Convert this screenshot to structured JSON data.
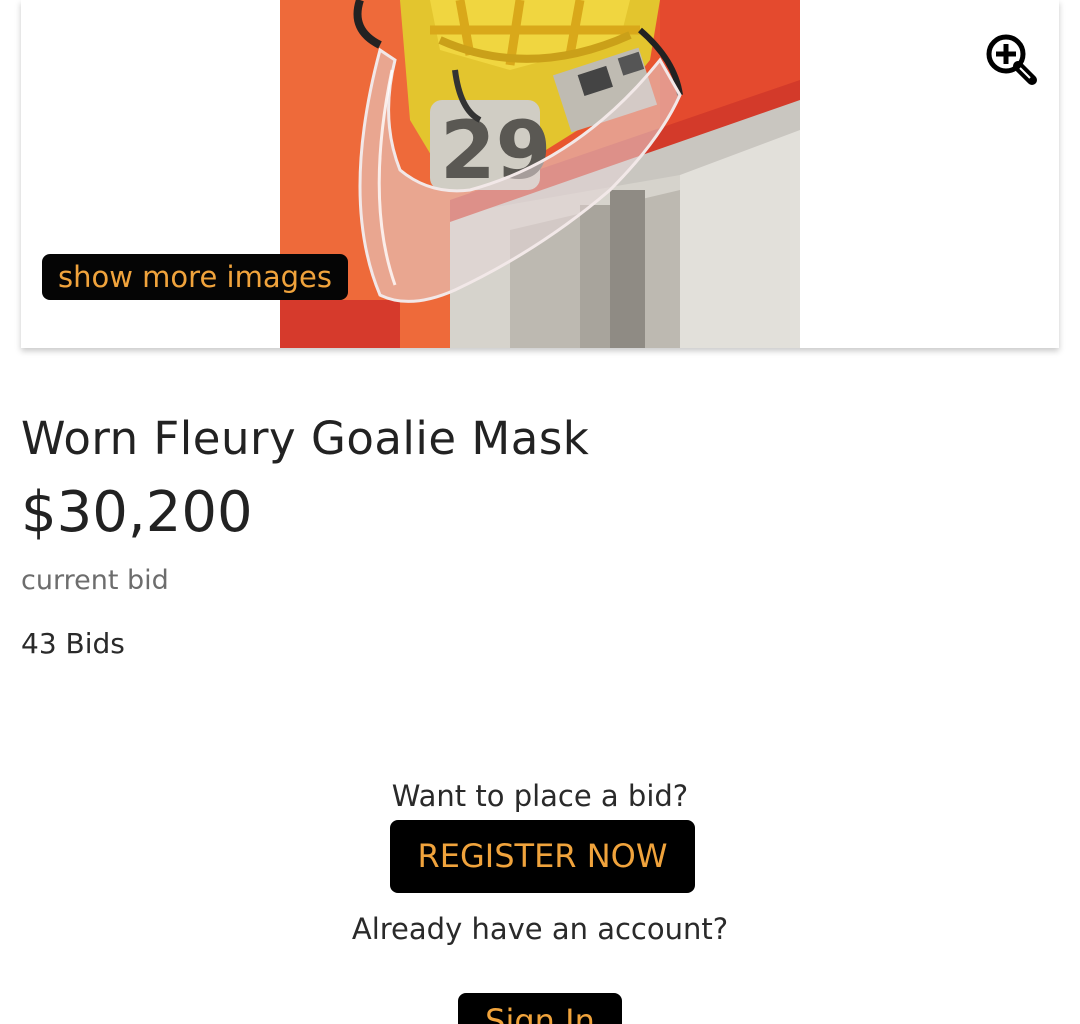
{
  "gallery": {
    "more_images_label": "show more images",
    "zoom_icon": "zoom-in-icon",
    "photo_subject": "goalie-mask-photo",
    "photo_mask_number": "29"
  },
  "item": {
    "title": "Worn Fleury Goalie Mask",
    "price": "$30,200",
    "price_caption": "current bid",
    "bid_count": "43 Bids"
  },
  "cta": {
    "bid_question": "Want to place a bid?",
    "register_label": "REGISTER NOW",
    "account_question": "Already have an account?",
    "signin_label": "Sign In"
  },
  "colors": {
    "button_bg": "#000000",
    "button_text": "#f0a33c",
    "text": "#222222",
    "muted_text": "#6d6d6d"
  }
}
